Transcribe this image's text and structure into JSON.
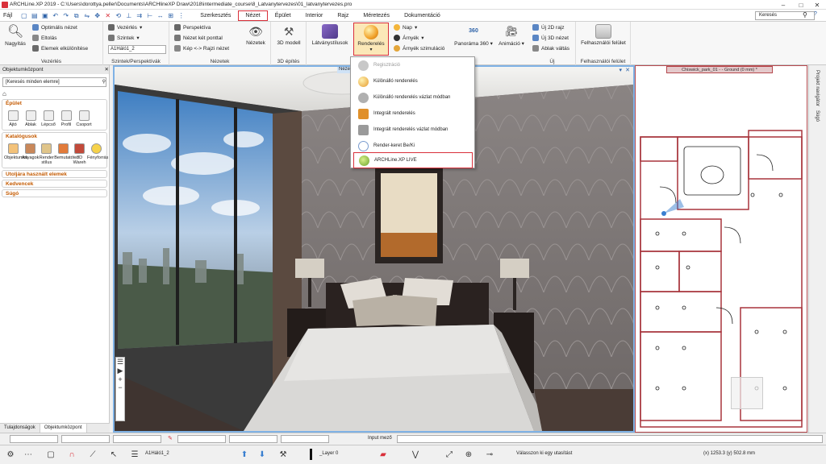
{
  "window": {
    "title": "ARCHLine.XP 2019 - C:\\Users\\dorottya.peller\\Documents\\ARCHlineXP Draw\\2018\\intermediate_course\\8_Latvanytervezes\\01_latvanytervezes.pro"
  },
  "menu": {
    "file": "Fájl",
    "tabs": [
      "Szerkesztés",
      "Nézet",
      "Épület",
      "Interior",
      "Rajz",
      "Méretezés",
      "Dokumentáció"
    ],
    "selected": "Nézet",
    "search_placeholder": "Keresés"
  },
  "ribbon": {
    "zoom": {
      "zoom_btn": "Nagyítás",
      "optimal": "Optimális nézet",
      "move": "Eltolás",
      "isolate": "Elemek elkülönítése",
      "label": "Vezérlés"
    },
    "levels": {
      "vezerles": "Vezérlés",
      "szintek": "Szintek",
      "level_value": "A1Háló1_2",
      "label": "Szintek/Perspektívák"
    },
    "views": {
      "perspective": "Perspektíva",
      "two_points": "Nézet két ponttal",
      "image_plan": "Kép <-> Rajzi nézet",
      "nezetek": "Nézetek",
      "label": "Nézetek"
    },
    "build3d": {
      "btn": "3D modell",
      "label": "3D építés"
    },
    "render": {
      "styles": "Látványstílusok",
      "render": "Renderelés",
      "sun": "Nap",
      "shadow": "Árnyék",
      "shadow_sim": "Árnyék szimuláció",
      "panorama": "Panoráma 360",
      "animation": "Animáció",
      "badge360": "360"
    },
    "new": {
      "new2d": "Új 2D rajz",
      "new3d": "Új 3D nézet",
      "window_switch": "Ablak váltás",
      "label": "Új"
    },
    "ui": {
      "btn": "Felhasználói felület",
      "label": "Felhasználói felület"
    }
  },
  "dropdown": {
    "items": [
      {
        "label": "Regisztráció",
        "icon": "registration-icon",
        "color": "#b0b0b0",
        "dim": true
      },
      {
        "label": "Különálló renderelés",
        "icon": "render-sphere-icon",
        "color": "#e59a2e"
      },
      {
        "label": "Különálló renderelés vázlat módban",
        "icon": "render-sketch-icon",
        "color": "#a0a0a0"
      },
      {
        "label": "Integrált renderelés",
        "icon": "integrated-render-icon",
        "color": "#e0902a"
      },
      {
        "label": "Integrált renderelés vázlat módban",
        "icon": "integrated-sketch-icon",
        "color": "#9a9a9a"
      },
      {
        "label": "Render-keret Be/Ki",
        "icon": "render-frame-icon",
        "color": "#7a9ccf"
      },
      {
        "label": "ARCHLine.XP LIVE",
        "icon": "live-icon",
        "color": "#8cc63f"
      }
    ]
  },
  "left_panel": {
    "title": "Objektumközpont",
    "search": "[Keresés minden elemre]",
    "sections": {
      "epulet": {
        "title": "Épület",
        "items": [
          "Ajtó",
          "Ablak",
          "Lépcső",
          "Profil",
          "Csoport"
        ]
      },
      "katalogusok": {
        "title": "Katalógusok",
        "items": [
          "Objektumok",
          "Anyagok",
          "Render stílus",
          "Bemutatóter",
          "3D Wareh",
          "Fényforrás"
        ]
      },
      "recent": "Utoljára használt elemek",
      "favs": "Kedvencek",
      "help": "Súgó"
    },
    "tabs": [
      "Tulajdonságok",
      "Objektumközpont"
    ]
  },
  "view3d": {
    "tab": "Nézet 3"
  },
  "plan": {
    "tab": "Chiswick_park_01 - - Ground (0 mm) *"
  },
  "right_strip": {
    "navigator": "Projekt navigátor",
    "help": "Súgó"
  },
  "status": {
    "input_label": "Input mező",
    "level": "A1Háló1_2",
    "layer": "_Layer 0",
    "prompt": "Válasszon ki egy utasítást",
    "coords": "(x) 1253.3  (y) 502.8 mm"
  }
}
